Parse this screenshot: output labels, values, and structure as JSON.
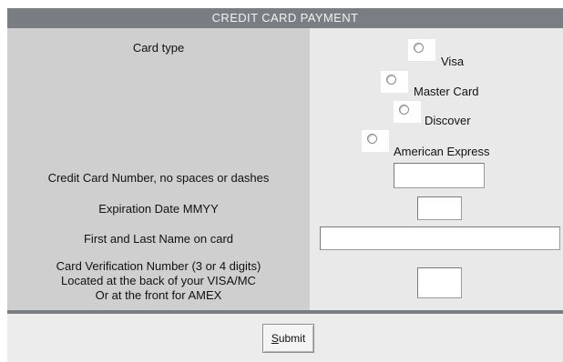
{
  "form": {
    "title": "CREDIT CARD PAYMENT",
    "card_type_label": "Card type",
    "card_options": [
      "Visa",
      "Master Card",
      "Discover",
      "American Express"
    ],
    "card_number_label": "Credit Card Number, no spaces or dashes",
    "card_number_value": "",
    "expiration_label": "Expiration Date MMYY",
    "expiration_value": "",
    "name_label": "First and Last Name on card",
    "name_value": "",
    "cvv_label_lines": [
      "Card Verification Number (3 or 4 digits)",
      "Located at the back of your VISA/MC",
      "Or at the front for AMEX"
    ],
    "cvv_value": "",
    "submit_accesskey": "S",
    "submit_rest": "ubmit"
  }
}
